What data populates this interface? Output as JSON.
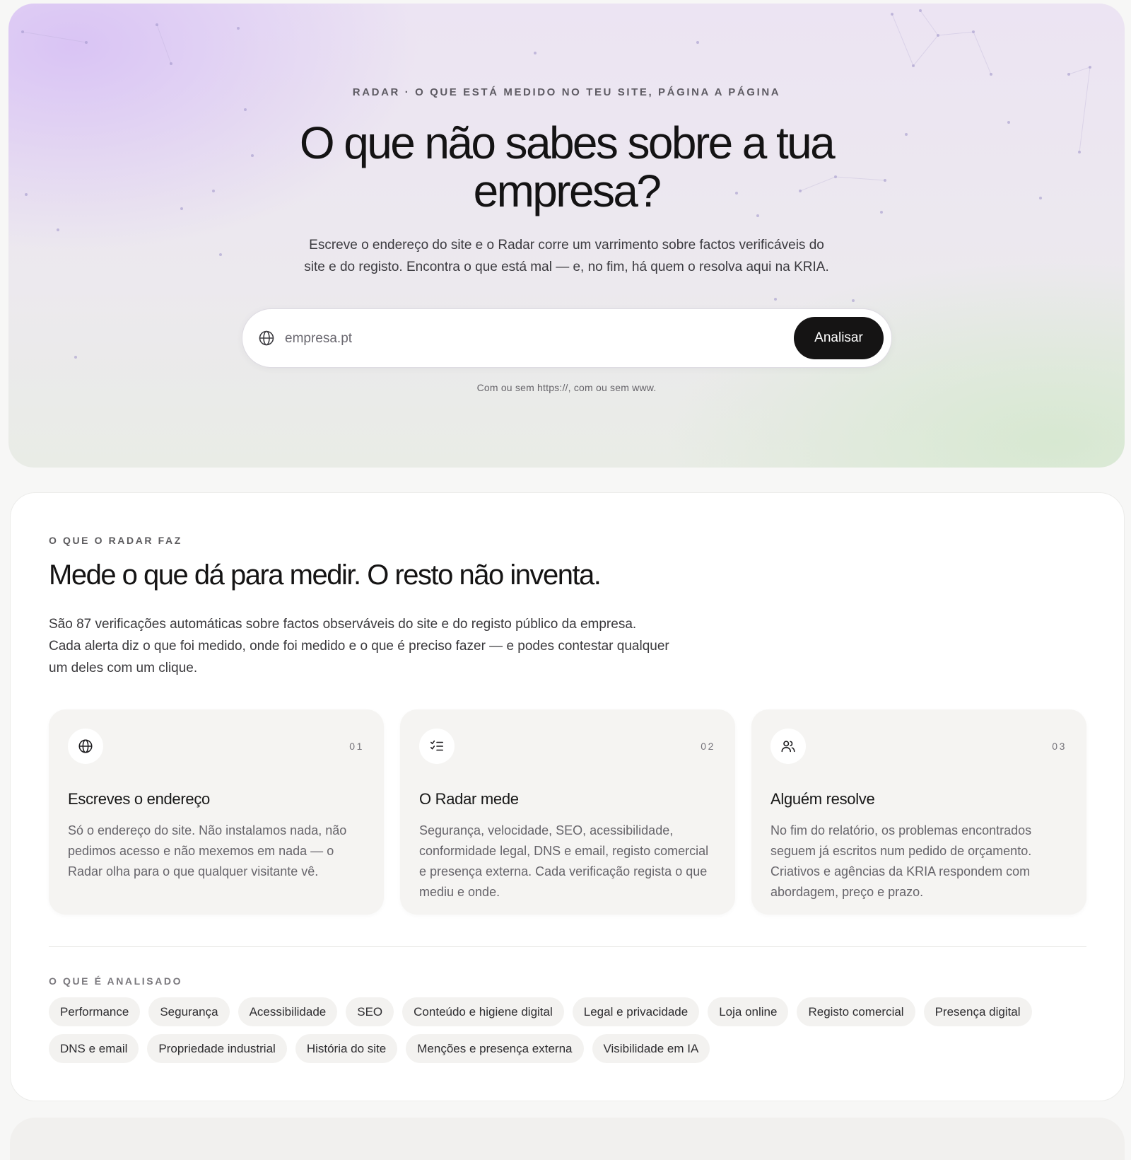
{
  "hero": {
    "eyebrow": "RADAR · O QUE ESTÁ MEDIDO NO TEU SITE, PÁGINA A PÁGINA",
    "title_line1": "O que não sabes sobre a tua",
    "title_line2": "empresa?",
    "subtitle_line1": "Escreve o endereço do site e o Radar corre um varrimento sobre factos verificáveis do",
    "subtitle_line2": "site e do registo. Encontra o que está mal — e, no fim, há quem o resolva aqui na KRIA.",
    "search": {
      "icon": "globe-icon",
      "placeholder": "empresa.pt",
      "value": "",
      "button_label": "Analisar"
    },
    "hint": "Com ou sem https://, com ou sem www."
  },
  "section": {
    "eyebrow": "O QUE O RADAR FAZ",
    "title": "Mede o que dá para medir. O resto não inventa.",
    "text_line1": "São 87 verificações automáticas sobre factos observáveis do site e do registo público da empresa.",
    "text_line2": "Cada alerta diz o que foi medido, onde foi medido e o que é preciso fazer — e podes contestar qualquer",
    "text_line3": "um deles com um clique.",
    "cards": [
      {
        "icon": "globe-icon",
        "number": "01",
        "title": "Escreves o endereço",
        "text": "Só o endereço do site. Não instalamos nada, não pedimos acesso e não mexemos em nada — o Radar olha para o que qualquer visitante vê."
      },
      {
        "icon": "checklist-icon",
        "number": "02",
        "title": "O Radar mede",
        "text": "Segurança, velocidade, SEO, acessibilidade, conformidade legal, DNS e email, registo comercial e presença externa. Cada verificação regista o que mediu e onde."
      },
      {
        "icon": "users-icon",
        "number": "03",
        "title": "Alguém resolve",
        "text": "No fim do relatório, os problemas encontrados seguem já escritos num pedido de orçamento. Criativos e agências da KRIA respondem com abordagem, preço e prazo."
      }
    ],
    "tags_eyebrow": "O QUE É ANALISADO",
    "tags": [
      "Performance",
      "Segurança",
      "Acessibilidade",
      "SEO",
      "Conteúdo e higiene digital",
      "Legal e privacidade",
      "Loja online",
      "Registo comercial",
      "Presença digital",
      "DNS e email",
      "Propriedade industrial",
      "História do site",
      "Menções e presença externa",
      "Visibilidade em IA"
    ]
  },
  "colors": {
    "accent_dark": "#151414",
    "hero_purple": "#d6bef5",
    "hero_green": "#d6e8d0",
    "card_bg": "#f5f4f2"
  }
}
